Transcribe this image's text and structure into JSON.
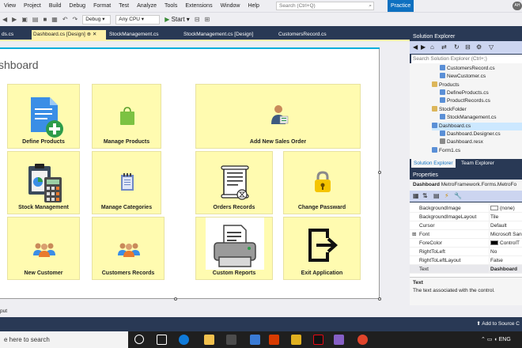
{
  "menu": {
    "items": [
      "View",
      "Project",
      "Build",
      "Debug",
      "Format",
      "Test",
      "Analyze",
      "Tools",
      "Extensions",
      "Window",
      "Help"
    ],
    "search_placeholder": "Search (Ctrl+Q)",
    "practice_label": "Practice",
    "avatar_initials": "AH"
  },
  "toolbar": {
    "config": "Debug",
    "platform": "Any CPU",
    "start_label": "Start"
  },
  "tabs": [
    {
      "label": "ds.cs",
      "active": false
    },
    {
      "label": "Dashboard.cs [Design]",
      "active": true
    },
    {
      "label": "StockManagement.cs",
      "active": false
    },
    {
      "label": "StockManagement.cs [Design]",
      "active": false
    },
    {
      "label": "CustomersRecord.cs",
      "active": false
    }
  ],
  "designer": {
    "form_title": "shboard",
    "tiles": [
      {
        "label": "Define Products",
        "icon": "document-add-icon"
      },
      {
        "label": "Manage Products",
        "icon": "shopping-bag-icon"
      },
      {
        "label": "Add New Sales Order",
        "icon": "salesperson-icon"
      },
      {
        "label": "Stock Management",
        "icon": "calculator-clipboard-icon"
      },
      {
        "label": "Manage Categories",
        "icon": "notepad-icon"
      },
      {
        "label": "Orders Records",
        "icon": "scroll-hourglass-icon"
      },
      {
        "label": "Change Passward",
        "icon": "padlock-icon"
      },
      {
        "label": "New Customer",
        "icon": "users-group-icon"
      },
      {
        "label": "Customers Records",
        "icon": "users-group-icon"
      },
      {
        "label": "Custom Reports",
        "icon": "printer-icon"
      },
      {
        "label": "Exit Application",
        "icon": "exit-icon"
      }
    ]
  },
  "solution_explorer": {
    "title": "Solution Explorer",
    "search_placeholder": "Search Solution Explorer (Ctrl+;)",
    "items": [
      {
        "label": "CustomersRecord.cs",
        "indent": 3,
        "selected": false
      },
      {
        "label": "NewCustomer.cs",
        "indent": 3,
        "selected": false
      },
      {
        "label": "Products",
        "indent": 2,
        "selected": false
      },
      {
        "label": "DefineProducts.cs",
        "indent": 3,
        "selected": false
      },
      {
        "label": "ProductRecords.cs",
        "indent": 3,
        "selected": false
      },
      {
        "label": "StockFolder",
        "indent": 2,
        "selected": false
      },
      {
        "label": "StockManagement.cs",
        "indent": 3,
        "selected": false
      },
      {
        "label": "Dashboard.cs",
        "indent": 2,
        "selected": true
      },
      {
        "label": "Dashboard.Designer.cs",
        "indent": 3,
        "selected": false
      },
      {
        "label": "Dashboard.resx",
        "indent": 3,
        "selected": false
      },
      {
        "label": "Form1.cs",
        "indent": 2,
        "selected": false
      }
    ],
    "bottom_tabs": [
      "Solution Explorer",
      "Team Explorer"
    ]
  },
  "properties": {
    "title": "Properties",
    "object_name": "Dashboard",
    "object_type": "MetroFramework.Forms.MetroFo",
    "rows": [
      {
        "name": "BackgroundImage",
        "value": "(none)",
        "swatch": "#ffffff"
      },
      {
        "name": "BackgroundImageLayout",
        "value": "Tile",
        "swatch": ""
      },
      {
        "name": "Cursor",
        "value": "Default",
        "swatch": ""
      },
      {
        "name": "Font",
        "value": "Microsoft San",
        "swatch": "",
        "expand": "⊞"
      },
      {
        "name": "ForeColor",
        "value": "ControlT",
        "swatch": "#000000"
      },
      {
        "name": "RightToLeft",
        "value": "No",
        "swatch": ""
      },
      {
        "name": "RightToLeftLayout",
        "value": "False",
        "swatch": ""
      },
      {
        "name": "Text",
        "value": "Dashboard",
        "swatch": ""
      }
    ],
    "desc_title": "Text",
    "desc_text": "The text associated with the control."
  },
  "output_label": "put",
  "status": {
    "add_source": "Add to Source C"
  },
  "taskbar": {
    "search_placeholder": "e here to search",
    "language": "ENG"
  },
  "colors": {
    "vs_navy": "#293955",
    "tile_yellow": "#fffbb0",
    "accent_blue": "#0e70c0",
    "form_accent": "#00aedb"
  }
}
